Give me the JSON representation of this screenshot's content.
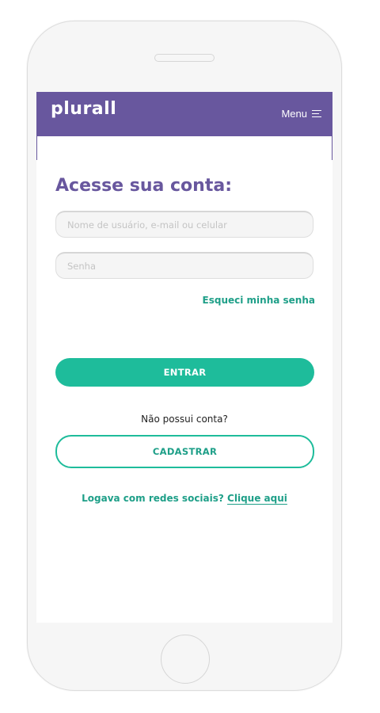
{
  "header": {
    "logo_text": "plurall",
    "menu_label": "Menu",
    "menu_icon": "hamburger-icon",
    "bg_color": "#68579e"
  },
  "login": {
    "title": "Acesse sua conta:",
    "username_placeholder": "Nome de usuário, e-mail ou celular",
    "password_placeholder": "Senha",
    "forgot_link": "Esqueci minha senha",
    "submit_label": "ENTRAR",
    "no_account_text": "Não possui conta?",
    "register_label": "CADASTRAR",
    "social_text": "Logava com redes sociais?",
    "social_link": "Clique aqui"
  },
  "colors": {
    "brand_purple": "#68579e",
    "accent_green": "#1ebc9b",
    "link_green": "#1e9f88"
  }
}
